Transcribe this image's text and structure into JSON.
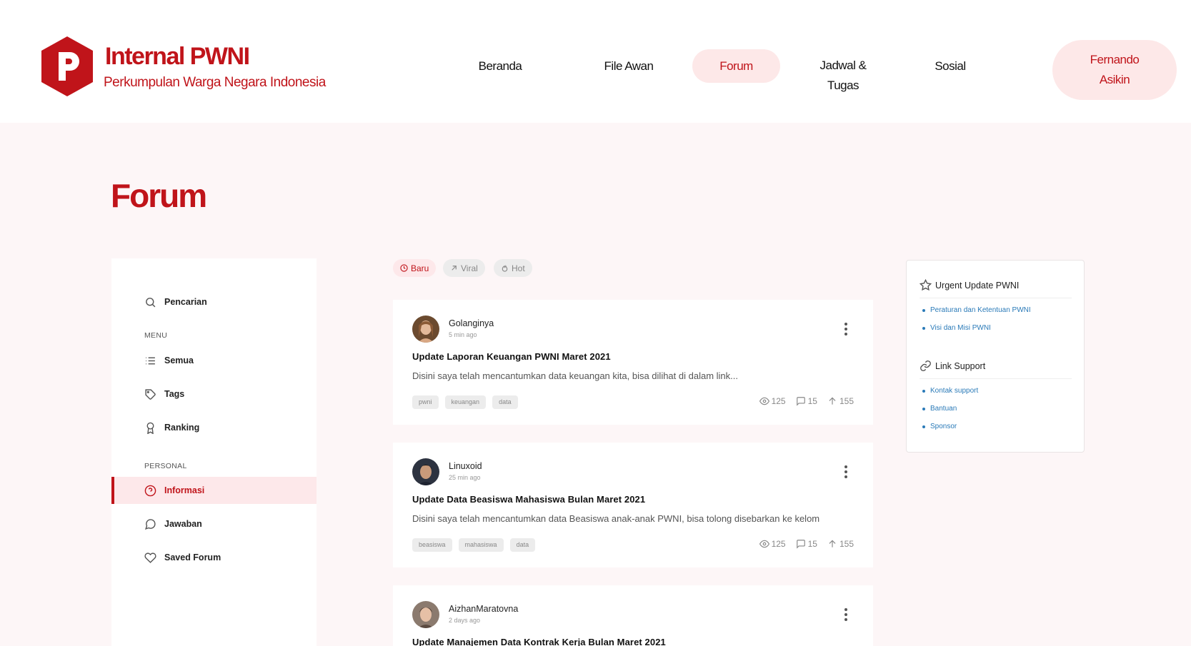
{
  "brand": {
    "title": "Internal PWNI",
    "subtitle": "Perkumpulan Warga Negara Indonesia",
    "accent": "#c0141a",
    "logo_icon": "p-logo-icon"
  },
  "nav": {
    "items": [
      {
        "label": "Beranda"
      },
      {
        "label": "File Awan"
      },
      {
        "label": "Forum",
        "active": true
      },
      {
        "label_line1": "Jadwal &",
        "label_line2": "Tugas"
      },
      {
        "label": "Sosial"
      }
    ],
    "user": {
      "line1": "Fernando",
      "line2": "Asikin"
    }
  },
  "page": {
    "title": "Forum"
  },
  "sidebar": {
    "search_label": "Pencarian",
    "menu_heading": "MENU",
    "menu": [
      {
        "label": "Semua",
        "icon": "list-icon"
      },
      {
        "label": "Tags",
        "icon": "tag-icon"
      },
      {
        "label": "Ranking",
        "icon": "award-icon"
      }
    ],
    "personal_heading": "PERSONAL",
    "personal": [
      {
        "label": "Informasi",
        "icon": "help-circle-icon",
        "active": true
      },
      {
        "label": "Jawaban",
        "icon": "message-circle-icon"
      },
      {
        "label": "Saved Forum",
        "icon": "heart-icon"
      }
    ]
  },
  "filters": [
    {
      "label": "Baru",
      "icon": "clock-icon",
      "active": true
    },
    {
      "label": "Viral",
      "icon": "trending-arrow-icon"
    },
    {
      "label": "Hot",
      "icon": "flame-icon"
    }
  ],
  "posts": [
    {
      "author": "Golanginya",
      "time": "5 min ago",
      "title": "Update Laporan Keuangan PWNI Maret 2021",
      "excerpt": "Disini saya telah mencantumkan data keuangan kita, bisa dilihat di dalam link...",
      "tags": [
        "pwni",
        "keuangan",
        "data"
      ],
      "views": "125",
      "comments": "15",
      "votes": "155"
    },
    {
      "author": "Linuxoid",
      "time": "25 min ago",
      "title": "Update Data Beasiswa Mahasiswa Bulan Maret 2021",
      "excerpt": "Disini saya telah mencantumkan data Beasiswa anak-anak PWNI, bisa tolong disebarkan ke kelom",
      "tags": [
        "beasiswa",
        "mahasiswa",
        "data"
      ],
      "views": "125",
      "comments": "15",
      "votes": "155"
    },
    {
      "author": "AizhanMaratovna",
      "time": "2 days ago",
      "title": "Update Manajemen Data Kontrak Kerja Bulan Maret 2021"
    }
  ],
  "right_panel": {
    "urgent_heading": "Urgent Update PWNI",
    "urgent_links": [
      "Peraturan dan Ketentuan PWNI",
      "Visi dan Misi PWNI"
    ],
    "support_heading": "Link Support",
    "support_links": [
      "Kontak support",
      "Bantuan",
      "Sponsor"
    ]
  }
}
